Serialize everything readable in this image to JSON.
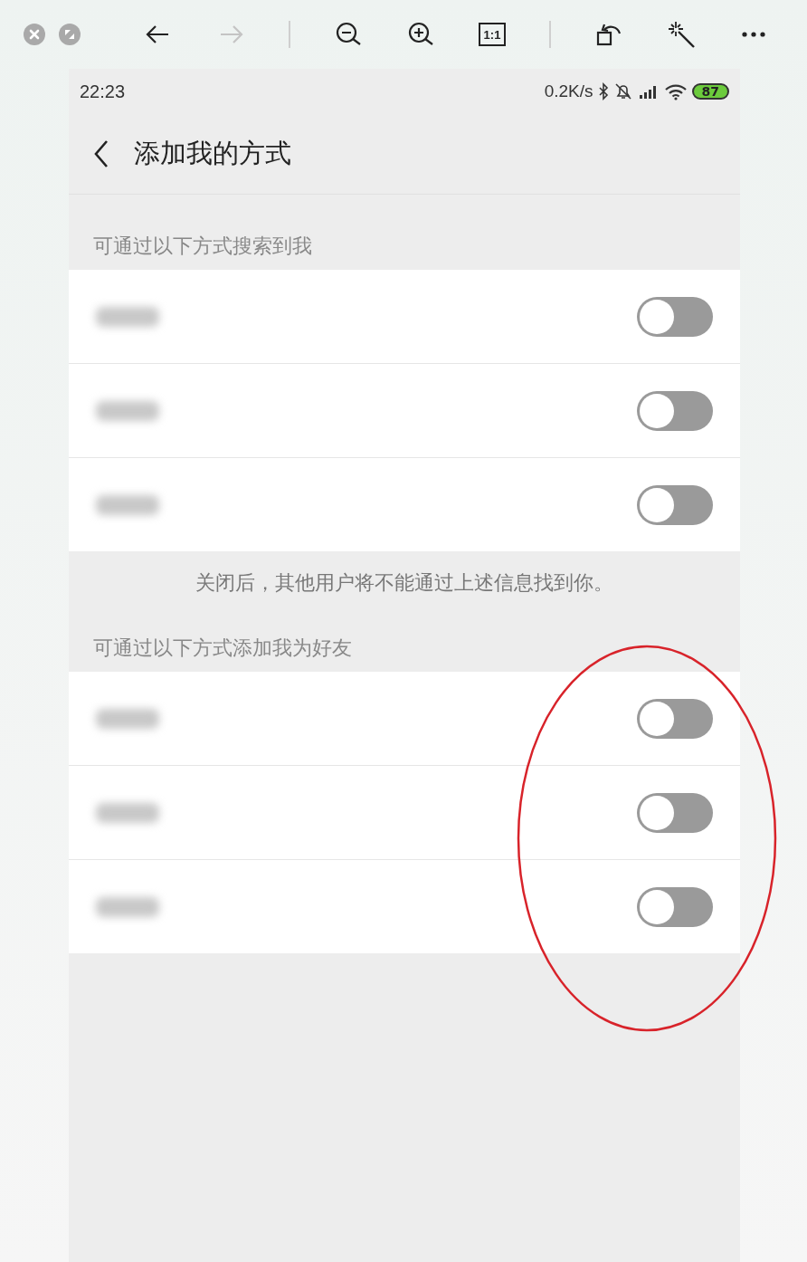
{
  "viewer_toolbar": {
    "window_buttons": [
      {
        "kind": "close"
      },
      {
        "kind": "fullscreen"
      }
    ],
    "tools": [
      {
        "kind": "back",
        "disabled": false
      },
      {
        "kind": "forward",
        "disabled": true
      },
      {
        "kind": "separator"
      },
      {
        "kind": "zoom-out",
        "disabled": false
      },
      {
        "kind": "zoom-in",
        "disabled": false
      },
      {
        "kind": "actual-size",
        "label": "1:1",
        "disabled": false
      },
      {
        "kind": "separator"
      },
      {
        "kind": "rotate",
        "disabled": false
      },
      {
        "kind": "enhance",
        "disabled": false
      },
      {
        "kind": "more",
        "disabled": false
      }
    ]
  },
  "phone": {
    "status_bar": {
      "time": "22:23",
      "speed": "0.2K/s",
      "battery": "87"
    },
    "title": "添加我的方式",
    "sections": [
      {
        "label": "可通过以下方式搜索到我",
        "rows": [
          {
            "on": false
          },
          {
            "on": false
          },
          {
            "on": false
          }
        ],
        "note": "关闭后，其他用户将不能通过上述信息找到你。"
      },
      {
        "label": "可通过以下方式添加我为好友",
        "rows": [
          {
            "on": false
          },
          {
            "on": false
          },
          {
            "on": false
          }
        ]
      }
    ]
  }
}
